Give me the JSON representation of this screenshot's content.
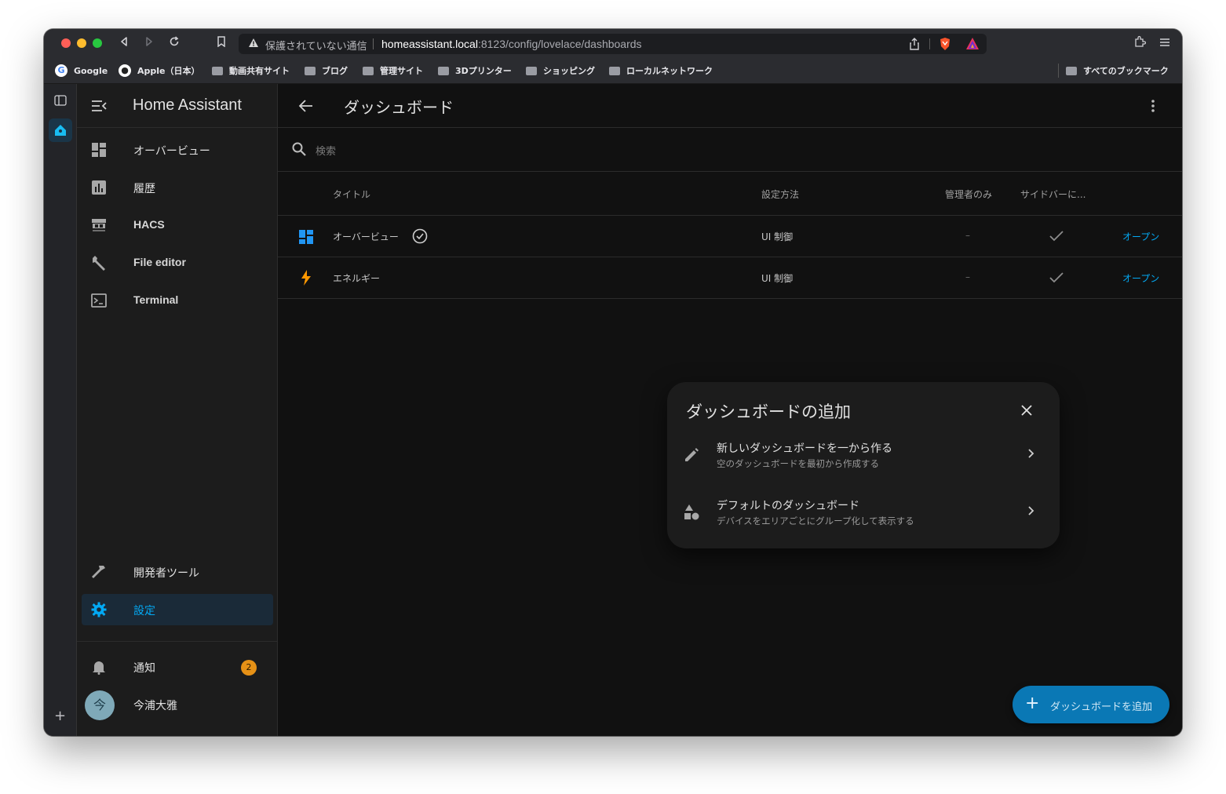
{
  "browser": {
    "insecure_label": "保護されていない通信",
    "url_host": "homeassistant.local",
    "url_path": ":8123/config/lovelace/dashboards",
    "bookmarks": [
      "Google",
      "Apple（日本）",
      "動画共有サイト",
      "ブログ",
      "管理サイト",
      "3Dプリンター",
      "ショッピング",
      "ローカルネットワーク"
    ],
    "all_bookmarks": "すべてのブックマーク"
  },
  "sidebar": {
    "app_title": "Home Assistant",
    "items": [
      {
        "label": "オーバービュー",
        "icon": "dashboard-icon"
      },
      {
        "label": "履歴",
        "icon": "chart-box-icon"
      },
      {
        "label": "HACS",
        "icon": "hacs-icon"
      },
      {
        "label": "File editor",
        "icon": "wrench-icon"
      },
      {
        "label": "Terminal",
        "icon": "console-icon"
      }
    ],
    "dev_tools": "開発者ツール",
    "settings": "設定",
    "notifications": "通知",
    "notification_count": "2",
    "user_name": "今浦大雅",
    "user_initial": "今"
  },
  "main": {
    "title": "ダッシュボード",
    "search_placeholder": "検索",
    "columns": {
      "title": "タイトル",
      "config": "設定方法",
      "admin": "管理者のみ",
      "sidebar": "サイドバーに..."
    },
    "rows": [
      {
        "title": "オーバービュー",
        "config": "UI 制御",
        "admin": "–",
        "open": "オープン",
        "icon": "dashboard-icon",
        "default": true
      },
      {
        "title": "エネルギー",
        "config": "UI 制御",
        "admin": "–",
        "open": "オープン",
        "icon": "lightning-bolt-icon",
        "default": false
      }
    ],
    "fab_label": "ダッシュボードを追加"
  },
  "dialog": {
    "title": "ダッシュボードの追加",
    "options": [
      {
        "title": "新しいダッシュボードを一から作る",
        "subtitle": "空のダッシュボードを最初から作成する",
        "icon": "pencil-icon"
      },
      {
        "title": "デフォルトのダッシュボード",
        "subtitle": "デバイスをエリアごとにグループ化して表示する",
        "icon": "shapes-icon"
      }
    ]
  },
  "colors": {
    "accent": "#03a9f4",
    "background": "#111111",
    "sidebar": "#1c1c1c",
    "badge": "#e69116"
  }
}
